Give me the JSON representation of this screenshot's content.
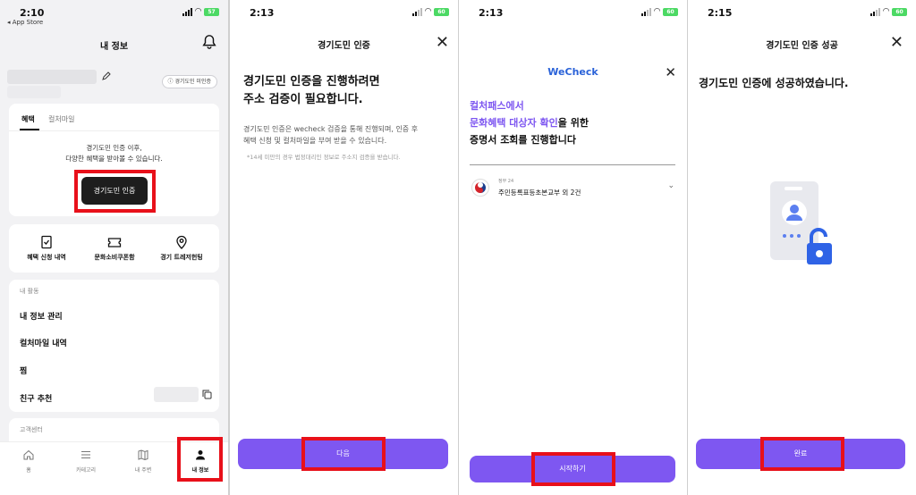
{
  "panel1": {
    "status": {
      "time": "2:10",
      "back_app": "◂ App Store",
      "battery": "57"
    },
    "title": "내 정보",
    "badge": "경기도민 미인증",
    "tabs": [
      "혜택",
      "컬처마일"
    ],
    "benefit_text": [
      "경기도민 인증 이후,",
      "다양한 혜택을 받아볼 수 있습니다."
    ],
    "verify_button": "경기도민 인증",
    "quick_actions": [
      "혜택 신청 내역",
      "문화소비쿠폰함",
      "경기 트레저헌팅"
    ],
    "my_activity_label": "내 활동",
    "menu": [
      "내 정보 관리",
      "컬처마일 내역",
      "찜",
      "친구 추천"
    ],
    "support_label": "고객센터",
    "nav": [
      "홈",
      "카테고리",
      "내 주변",
      "내 정보"
    ]
  },
  "panel2": {
    "status": {
      "time": "2:13",
      "battery": "60"
    },
    "title": "경기도민 인증",
    "heading": [
      "경기도민 인증을 진행하려면",
      "주소 검증이 필요합니다."
    ],
    "body": [
      "경기도민 인증은 wecheck 검증을 통해 진행되며, 인증 후",
      "혜택 신청 및 컬처마일을 부여 받을 수 있습니다."
    ],
    "note": "*14세 미만의 경우 법정대리인 정보로 주소지 검증을 받습니다.",
    "next_button": "다음"
  },
  "panel3": {
    "status": {
      "time": "2:13",
      "battery": "60"
    },
    "brand": "WeCheck",
    "line1": "컬처패스에서",
    "line2_highlight": "문화혜택 대상자 확인",
    "line2_rest": "을 위한",
    "line3": "증명서 조회를 진행합니다",
    "doc_source": "정부 24",
    "doc_title": "주민등록표등초본교부 외 2건",
    "start_button": "시작하기"
  },
  "panel4": {
    "status": {
      "time": "2:15",
      "battery": "60"
    },
    "title": "경기도민 인증 성공",
    "message": "경기도민 인증에 성공하였습니다.",
    "done_button": "완료"
  },
  "colors": {
    "accent": "#7e57f1",
    "highlight_box": "#e8101a",
    "wecheck_blue": "#2a62d8"
  }
}
